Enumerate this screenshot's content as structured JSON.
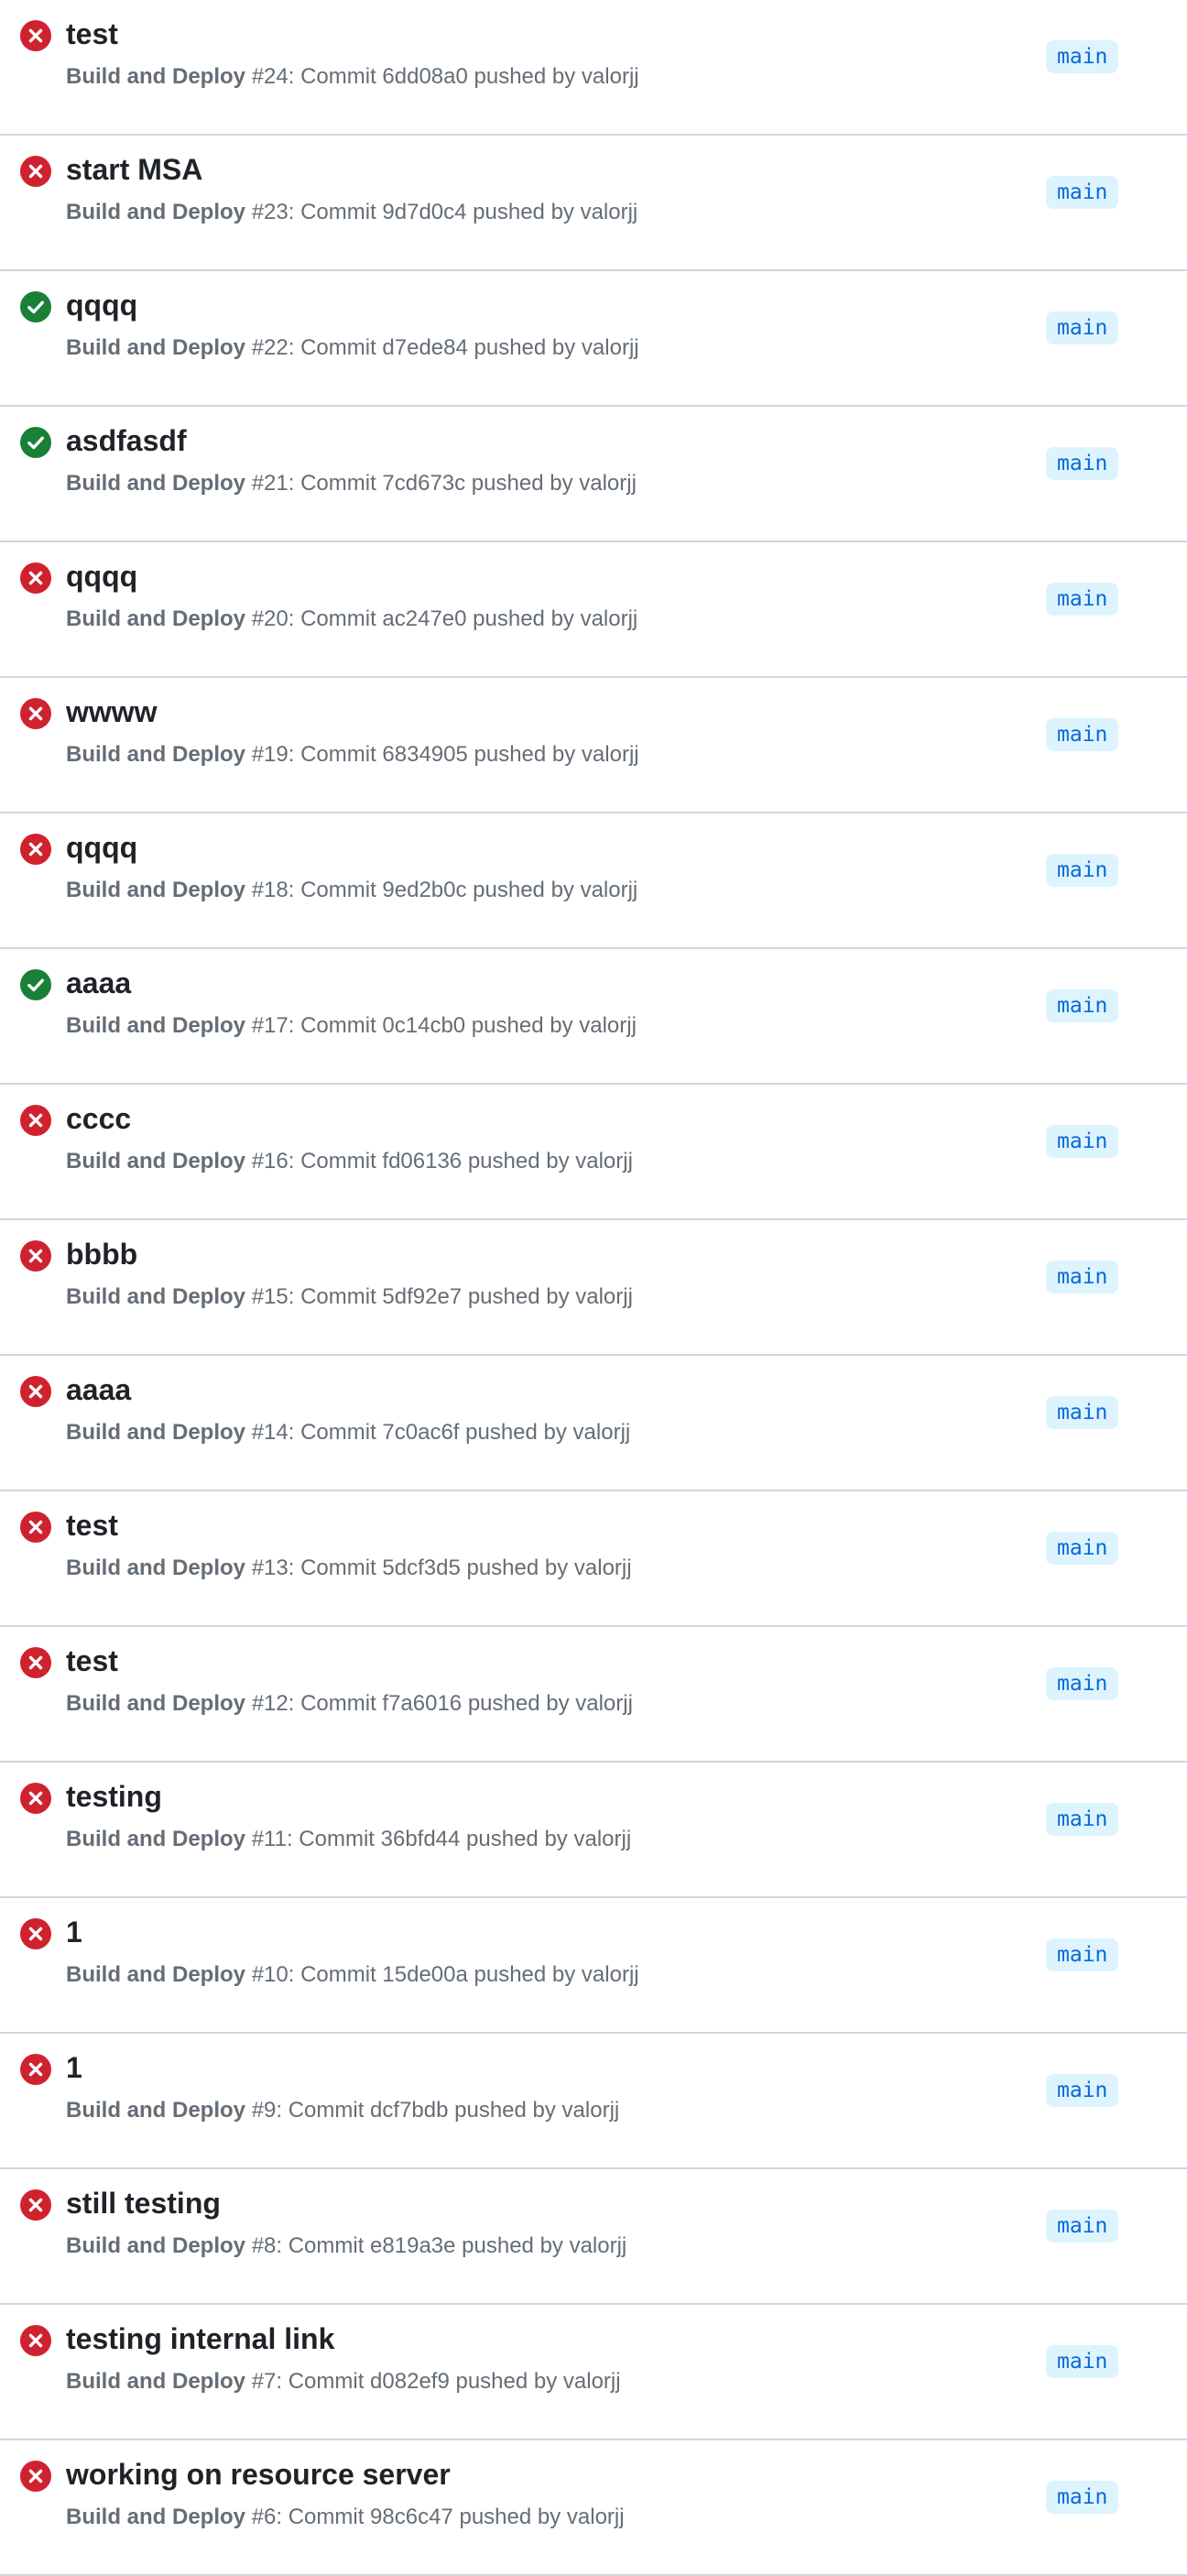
{
  "colors": {
    "failure": "#cf222e",
    "success": "#1a7f37",
    "branch_bg": "#ddf4ff",
    "branch_text": "#0969da",
    "divider": "#d0d7de"
  },
  "runs": [
    {
      "status": "failure",
      "icon": "x-circle-icon",
      "title": "test",
      "workflow": "Build and Deploy",
      "number": "#24",
      "detail": ": Commit 6dd08a0 pushed by valorjj",
      "branch": "main"
    },
    {
      "status": "failure",
      "icon": "x-circle-icon",
      "title": "start MSA",
      "workflow": "Build and Deploy",
      "number": "#23",
      "detail": ": Commit 9d7d0c4 pushed by valorjj",
      "branch": "main"
    },
    {
      "status": "success",
      "icon": "check-circle-icon",
      "title": "qqqq",
      "workflow": "Build and Deploy",
      "number": "#22",
      "detail": ": Commit d7ede84 pushed by valorjj",
      "branch": "main"
    },
    {
      "status": "success",
      "icon": "check-circle-icon",
      "title": "asdfasdf",
      "workflow": "Build and Deploy",
      "number": "#21",
      "detail": ": Commit 7cd673c pushed by valorjj",
      "branch": "main"
    },
    {
      "status": "failure",
      "icon": "x-circle-icon",
      "title": "qqqq",
      "workflow": "Build and Deploy",
      "number": "#20",
      "detail": ": Commit ac247e0 pushed by valorjj",
      "branch": "main"
    },
    {
      "status": "failure",
      "icon": "x-circle-icon",
      "title": "wwww",
      "workflow": "Build and Deploy",
      "number": "#19",
      "detail": ": Commit 6834905 pushed by valorjj",
      "branch": "main"
    },
    {
      "status": "failure",
      "icon": "x-circle-icon",
      "title": "qqqq",
      "workflow": "Build and Deploy",
      "number": "#18",
      "detail": ": Commit 9ed2b0c pushed by valorjj",
      "branch": "main"
    },
    {
      "status": "success",
      "icon": "check-circle-icon",
      "title": "aaaa",
      "workflow": "Build and Deploy",
      "number": "#17",
      "detail": ": Commit 0c14cb0 pushed by valorjj",
      "branch": "main"
    },
    {
      "status": "failure",
      "icon": "x-circle-icon",
      "title": "cccc",
      "workflow": "Build and Deploy",
      "number": "#16",
      "detail": ": Commit fd06136 pushed by valorjj",
      "branch": "main"
    },
    {
      "status": "failure",
      "icon": "x-circle-icon",
      "title": "bbbb",
      "workflow": "Build and Deploy",
      "number": "#15",
      "detail": ": Commit 5df92e7 pushed by valorjj",
      "branch": "main"
    },
    {
      "status": "failure",
      "icon": "x-circle-icon",
      "title": "aaaa",
      "workflow": "Build and Deploy",
      "number": "#14",
      "detail": ": Commit 7c0ac6f pushed by valorjj",
      "branch": "main"
    },
    {
      "status": "failure",
      "icon": "x-circle-icon",
      "title": "test",
      "workflow": "Build and Deploy",
      "number": "#13",
      "detail": ": Commit 5dcf3d5 pushed by valorjj",
      "branch": "main"
    },
    {
      "status": "failure",
      "icon": "x-circle-icon",
      "title": "test",
      "workflow": "Build and Deploy",
      "number": "#12",
      "detail": ": Commit f7a6016 pushed by valorjj",
      "branch": "main"
    },
    {
      "status": "failure",
      "icon": "x-circle-icon",
      "title": "testing",
      "workflow": "Build and Deploy",
      "number": "#11",
      "detail": ": Commit 36bfd44 pushed by valorjj",
      "branch": "main"
    },
    {
      "status": "failure",
      "icon": "x-circle-icon",
      "title": "1",
      "workflow": "Build and Deploy",
      "number": "#10",
      "detail": ": Commit 15de00a pushed by valorjj",
      "branch": "main"
    },
    {
      "status": "failure",
      "icon": "x-circle-icon",
      "title": "1",
      "workflow": "Build and Deploy",
      "number": "#9",
      "detail": ": Commit dcf7bdb pushed by valorjj",
      "branch": "main"
    },
    {
      "status": "failure",
      "icon": "x-circle-icon",
      "title": "still testing",
      "workflow": "Build and Deploy",
      "number": "#8",
      "detail": ": Commit e819a3e pushed by valorjj",
      "branch": "main"
    },
    {
      "status": "failure",
      "icon": "x-circle-icon",
      "title": "testing internal link",
      "workflow": "Build and Deploy",
      "number": "#7",
      "detail": ": Commit d082ef9 pushed by valorjj",
      "branch": "main"
    },
    {
      "status": "failure",
      "icon": "x-circle-icon",
      "title": "working on resource server",
      "workflow": "Build and Deploy",
      "number": "#6",
      "detail": ": Commit 98c6c47 pushed by valorjj",
      "branch": "main"
    }
  ]
}
